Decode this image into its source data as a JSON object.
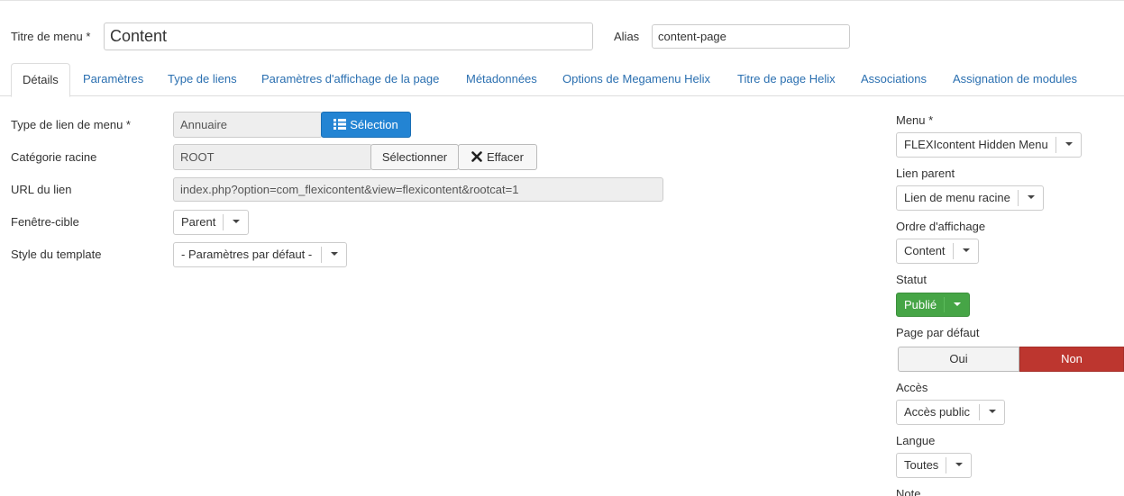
{
  "header": {
    "title_label": "Titre de menu *",
    "title_value": "Content",
    "alias_label": "Alias",
    "alias_value": "content-page"
  },
  "tabs": [
    {
      "label": "Détails",
      "active": true
    },
    {
      "label": "Paramètres"
    },
    {
      "label": "Type de liens"
    },
    {
      "label": "Paramètres d'affichage de la page"
    },
    {
      "label": "Métadonnées"
    },
    {
      "label": "Options de Megamenu Helix"
    },
    {
      "label": "Titre de page Helix"
    },
    {
      "label": "Associations"
    },
    {
      "label": "Assignation de modules"
    }
  ],
  "form": {
    "type_label": "Type de lien de menu *",
    "type_value": "Annuaire",
    "type_button": "Sélection",
    "category_label": "Catégorie racine",
    "category_value": "ROOT",
    "category_select_button": "Sélectionner",
    "category_clear_button": "Effacer",
    "url_label": "URL du lien",
    "url_value": "index.php?option=com_flexicontent&view=flexicontent&rootcat=1",
    "target_label": "Fenêtre-cible",
    "target_value": "Parent",
    "template_label": "Style du template",
    "template_value": "- Paramètres par défaut -"
  },
  "sidebar": {
    "menu_label": "Menu *",
    "menu_value": "FLEXIcontent Hidden Menu",
    "parent_label": "Lien parent",
    "parent_value": "Lien de menu racine",
    "order_label": "Ordre d'affichage",
    "order_value": "Content",
    "status_label": "Statut",
    "status_value": "Publié",
    "default_label": "Page par défaut",
    "default_yes": "Oui",
    "default_no": "Non",
    "access_label": "Accès",
    "access_value": "Accès public",
    "language_label": "Langue",
    "language_value": "Toutes",
    "note_label": "Note"
  },
  "colors": {
    "link": "#2a6fb0",
    "primary": "#2384d3",
    "success": "#46a546",
    "danger": "#bd362f"
  },
  "icons": {
    "selection": "list-icon",
    "clear": "times-icon",
    "dropdown": "caret-down-icon"
  }
}
